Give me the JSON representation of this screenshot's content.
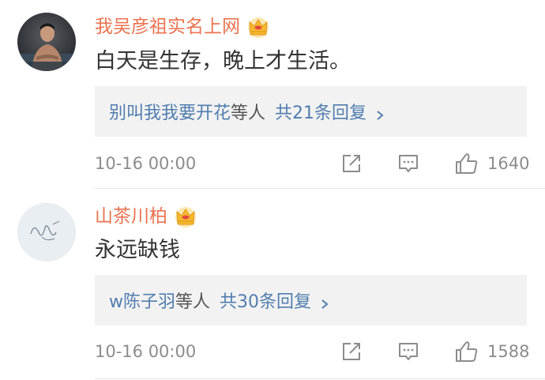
{
  "comments": [
    {
      "username": "我吴彦祖实名上网",
      "content": "白天是生存，晚上才生活。",
      "reply_names": "别叫我我要开花",
      "reply_suffix": "等人",
      "reply_count": "共21条回复",
      "timestamp": "10-16 00:00",
      "likes": "1640",
      "avatar_icon": "person-photo-icon",
      "badge_icon": "crown-icon"
    },
    {
      "username": "山茶川柏",
      "content": "永远缺钱",
      "reply_names": "w陈子羽",
      "reply_suffix": "等人",
      "reply_count": "共30条回复",
      "timestamp": "10-16 00:00",
      "likes": "1588",
      "avatar_icon": "sketch-avatar-icon",
      "badge_icon": "crown-icon"
    }
  ],
  "colors": {
    "username": "#eb7350",
    "link": "#507daf",
    "text": "#333333",
    "meta": "#8c8c8c",
    "reply_bg": "#f2f2f2",
    "crown_gold": "#f5b82e",
    "crown_red": "#e2463f"
  }
}
